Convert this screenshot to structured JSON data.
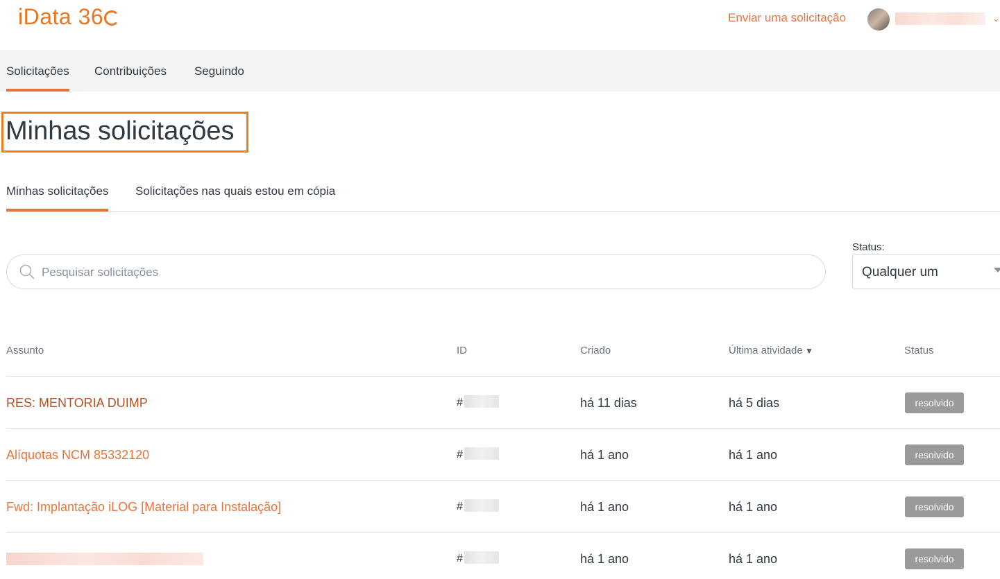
{
  "header": {
    "logo_text": "iData 36",
    "submit_request_label": "Enviar uma solicitação",
    "chevron": "⌄"
  },
  "nav": {
    "tabs": [
      {
        "label": "Solicitações",
        "active": true
      },
      {
        "label": "Contribuições",
        "active": false
      },
      {
        "label": "Seguindo",
        "active": false
      }
    ]
  },
  "page": {
    "title": "Minhas solicitações"
  },
  "subtabs": [
    {
      "label": "Minhas solicitações",
      "active": true
    },
    {
      "label": "Solicitações nas quais estou em cópia",
      "active": false
    }
  ],
  "search": {
    "placeholder": "Pesquisar solicitações",
    "value": ""
  },
  "status_filter": {
    "label": "Status:",
    "selected": "Qualquer um"
  },
  "table": {
    "headers": {
      "subject": "Assunto",
      "id": "ID",
      "created": "Criado",
      "last_activity": "Última atividade",
      "status": "Status"
    },
    "rows": [
      {
        "subject": "RES: MENTORIA DUIMP",
        "id_prefix": "#",
        "created": "há 11 dias",
        "last_activity": "há 5 dias",
        "status": "resolvido"
      },
      {
        "subject": "Alíquotas NCM 85332120",
        "id_prefix": "#",
        "created": "há 1 ano",
        "last_activity": "há 1 ano",
        "status": "resolvido"
      },
      {
        "subject": "Fwd: Implantação iLOG [Material para Instalação]",
        "id_prefix": "#",
        "created": "há 1 ano",
        "last_activity": "há 1 ano",
        "status": "resolvido"
      },
      {
        "subject": "",
        "id_prefix": "#",
        "created": "há 1 ano",
        "last_activity": "há 1 ano",
        "status": "resolvido"
      }
    ]
  },
  "colors": {
    "accent": "#e8743b",
    "visited_link": "#b55323",
    "highlight_border": "#ef7f1a",
    "badge_bg": "#9a9a9a"
  },
  "icons": {
    "search": "search-icon",
    "sort": "sort-desc-icon",
    "dropdown": "caret-down-icon"
  }
}
